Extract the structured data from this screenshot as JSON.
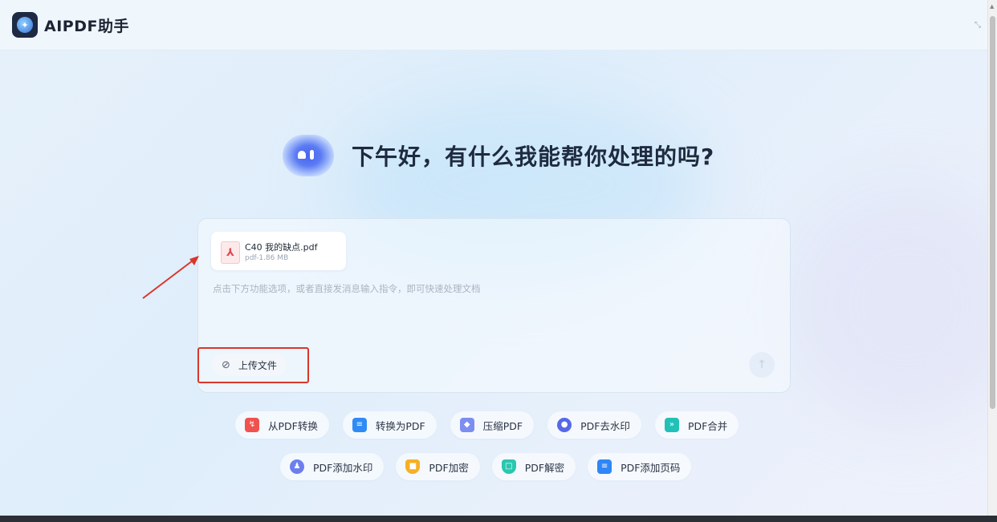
{
  "app": {
    "title": "AIPDF助手"
  },
  "greeting": "下午好，有什么我能帮你处理的吗?",
  "attachment": {
    "name": "C40 我的缺点.pdf",
    "meta": "pdf-1.86 MB",
    "icon": "pdf-file-icon"
  },
  "input": {
    "placeholder": "点击下方功能选项，或者直接发消息输入指令，即可快速处理文档",
    "value": ""
  },
  "upload_button": {
    "label": "上传文件",
    "icon": "paperclip-icon"
  },
  "send_button": {
    "icon": "send-icon"
  },
  "tools": {
    "row1": [
      {
        "label": "从PDF转换",
        "icon": "pdf-convert-from-icon",
        "color": "#f0524f"
      },
      {
        "label": "转换为PDF",
        "icon": "convert-to-pdf-icon",
        "color": "#2f8cf5"
      },
      {
        "label": "压缩PDF",
        "icon": "compress-icon",
        "color": "#7d8df0"
      },
      {
        "label": "PDF去水印",
        "icon": "remove-watermark-icon",
        "color": "#5668e8"
      },
      {
        "label": "PDF合并",
        "icon": "merge-icon",
        "color": "#22c1b6"
      }
    ],
    "row2": [
      {
        "label": "PDF添加水印",
        "icon": "add-watermark-icon",
        "color": "#6b7ff0"
      },
      {
        "label": "PDF加密",
        "icon": "encrypt-icon",
        "color": "#f5b025"
      },
      {
        "label": "PDF解密",
        "icon": "decrypt-icon",
        "color": "#28c7b0"
      },
      {
        "label": "PDF添加页码",
        "icon": "add-page-number-icon",
        "color": "#2f86f5"
      }
    ]
  },
  "annotation_color": "#d9362c"
}
